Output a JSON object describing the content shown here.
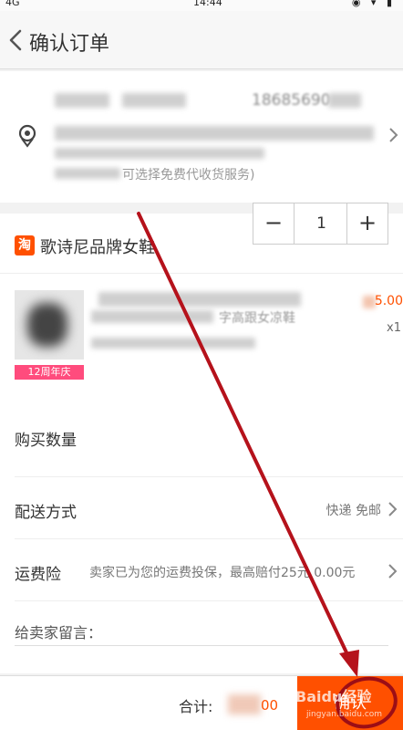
{
  "status_bar": {
    "carrier": "4G",
    "time": "14:44"
  },
  "nav": {
    "title": "确认订单"
  },
  "address": {
    "phone": "18685690",
    "note": "可选择免费代收货服务)"
  },
  "shop": {
    "icon_text": "淘",
    "name": "歌诗尼品牌女鞋"
  },
  "product": {
    "title_partial": "字高跟女凉鞋",
    "price_partial": "5.00",
    "quantity_label": "x1",
    "promo_badge": "12周年庆"
  },
  "purchase_qty": {
    "label": "购买数量",
    "minus": "−",
    "value": "1",
    "plus": "+"
  },
  "delivery": {
    "label": "配送方式",
    "value": "快递 免邮"
  },
  "insurance": {
    "label": "运费险",
    "value": "卖家已为您的运费投保，最高赔付25元 0.00元"
  },
  "message": {
    "placeholder": "给卖家留言："
  },
  "bottom": {
    "total_label": "合计:",
    "total_value": "00",
    "confirm_label": "确认"
  },
  "watermark": {
    "brand": "Baidu经验",
    "url": "jingyan.baidu.com"
  },
  "colors": {
    "accent": "#ff5000",
    "annotation": "#b5121b",
    "badge": "#ff4c7d"
  }
}
